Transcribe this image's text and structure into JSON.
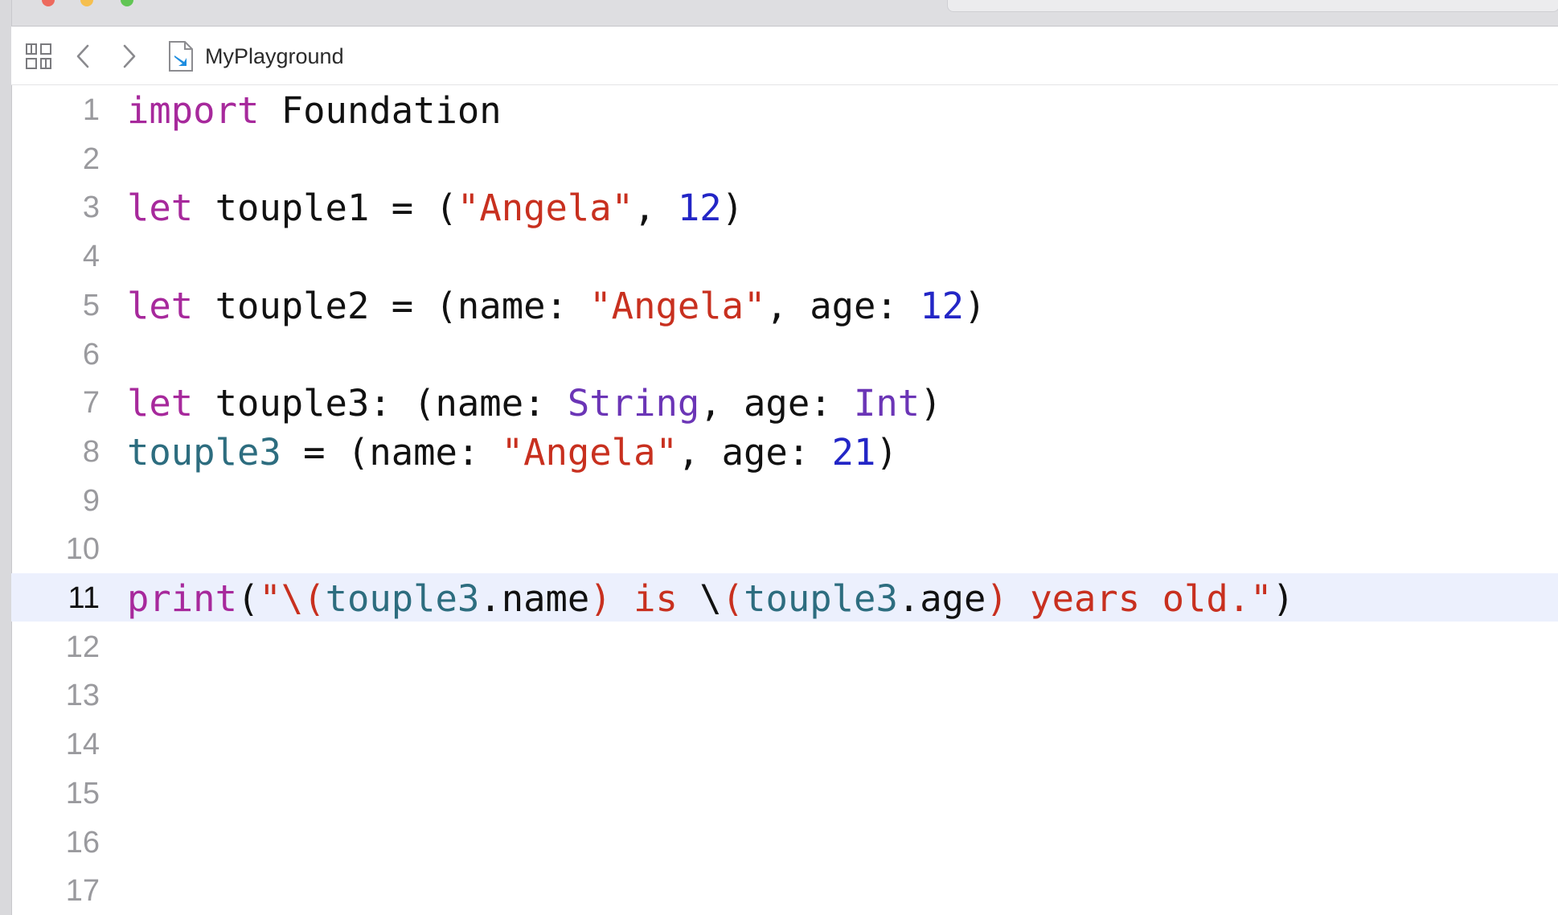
{
  "window": {
    "traffic_lights": [
      "#ed6a5e",
      "#f5bf4f",
      "#61c554"
    ]
  },
  "jumpbar": {
    "icons": [
      "grid-icon",
      "chevron-left-icon",
      "chevron-right-icon",
      "swift-file-icon"
    ],
    "file_name": "MyPlayground"
  },
  "editor": {
    "current_line": 11,
    "line_numbers": [
      "1",
      "2",
      "3",
      "4",
      "5",
      "6",
      "7",
      "8",
      "9",
      "10",
      "11",
      "12",
      "13",
      "14",
      "15",
      "16",
      "17"
    ],
    "lines": [
      {
        "tokens": [
          {
            "t": "import",
            "c": "keyword"
          },
          {
            "t": " Foundation",
            "c": "plain"
          }
        ]
      },
      {
        "tokens": []
      },
      {
        "tokens": [
          {
            "t": "let",
            "c": "keyword"
          },
          {
            "t": " touple1 = (",
            "c": "plain"
          },
          {
            "t": "\"Angela\"",
            "c": "string"
          },
          {
            "t": ", ",
            "c": "plain"
          },
          {
            "t": "12",
            "c": "number"
          },
          {
            "t": ")",
            "c": "plain"
          }
        ]
      },
      {
        "tokens": []
      },
      {
        "tokens": [
          {
            "t": "let",
            "c": "keyword"
          },
          {
            "t": " touple2 = (name: ",
            "c": "plain"
          },
          {
            "t": "\"Angela\"",
            "c": "string"
          },
          {
            "t": ", age: ",
            "c": "plain"
          },
          {
            "t": "12",
            "c": "number"
          },
          {
            "t": ")",
            "c": "plain"
          }
        ]
      },
      {
        "tokens": []
      },
      {
        "tokens": [
          {
            "t": "let",
            "c": "keyword"
          },
          {
            "t": " touple3: (name: ",
            "c": "plain"
          },
          {
            "t": "String",
            "c": "type"
          },
          {
            "t": ", age: ",
            "c": "plain"
          },
          {
            "t": "Int",
            "c": "type"
          },
          {
            "t": ")",
            "c": "plain"
          }
        ]
      },
      {
        "tokens": [
          {
            "t": "touple3",
            "c": "variable"
          },
          {
            "t": " = (name: ",
            "c": "plain"
          },
          {
            "t": "\"Angela\"",
            "c": "string"
          },
          {
            "t": ", age: ",
            "c": "plain"
          },
          {
            "t": "21",
            "c": "number"
          },
          {
            "t": ")",
            "c": "plain"
          }
        ]
      },
      {
        "tokens": []
      },
      {
        "tokens": []
      },
      {
        "tokens": [
          {
            "t": "print",
            "c": "keyword"
          },
          {
            "t": "(",
            "c": "plain"
          },
          {
            "t": "\"\\",
            "c": "string"
          },
          {
            "t": "(",
            "c": "string"
          },
          {
            "t": "touple3",
            "c": "variable"
          },
          {
            "t": ".name",
            "c": "plain"
          },
          {
            "t": ") is ",
            "c": "string"
          },
          {
            "t": "\\",
            "c": "plain"
          },
          {
            "t": "(",
            "c": "string"
          },
          {
            "t": "touple3",
            "c": "variable"
          },
          {
            "t": ".age",
            "c": "plain"
          },
          {
            "t": ") years old.\"",
            "c": "string"
          },
          {
            "t": ")",
            "c": "plain"
          }
        ]
      },
      {
        "tokens": []
      },
      {
        "tokens": []
      },
      {
        "tokens": []
      },
      {
        "tokens": []
      },
      {
        "tokens": []
      },
      {
        "tokens": []
      }
    ]
  },
  "colors": {
    "keyword": "#a7299c",
    "string": "#c8301f",
    "number": "#2326c6",
    "type": "#6b35b6",
    "variable": "#2d6d7f",
    "current_line_bg": "#ecf0fd"
  }
}
